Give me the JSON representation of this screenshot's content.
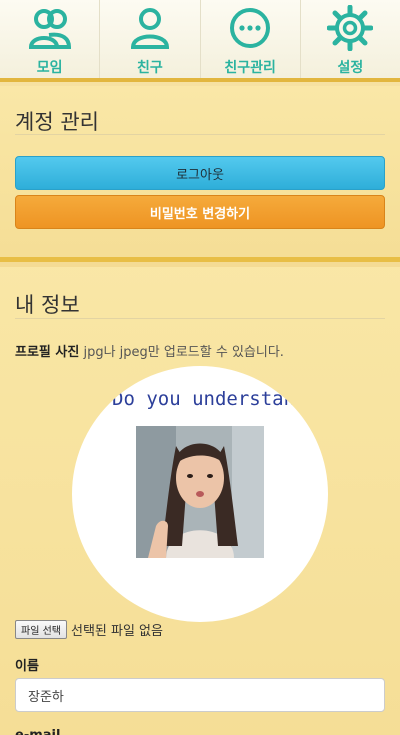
{
  "nav": {
    "items": [
      {
        "label": "모임",
        "icon": "group-icon"
      },
      {
        "label": "친구",
        "icon": "user-icon"
      },
      {
        "label": "친구관리",
        "icon": "more-icon"
      },
      {
        "label": "설정",
        "icon": "gear-icon"
      }
    ],
    "accent": "#2bb3a0"
  },
  "account": {
    "title": "계정 관리",
    "logout_label": "로그아웃",
    "change_password_label": "비밀번호 변경하기"
  },
  "profile": {
    "title": "내 정보",
    "photo_label": "프로필 사진",
    "photo_hint": "jpg나 jpeg만 업로드할 수 있습니다.",
    "avatar_caption": "Do you understand.",
    "file_button": "파일 선택",
    "file_status": "선택된 파일 없음",
    "name_label": "이름",
    "name_value": "장준하",
    "email_label": "e-mail"
  }
}
